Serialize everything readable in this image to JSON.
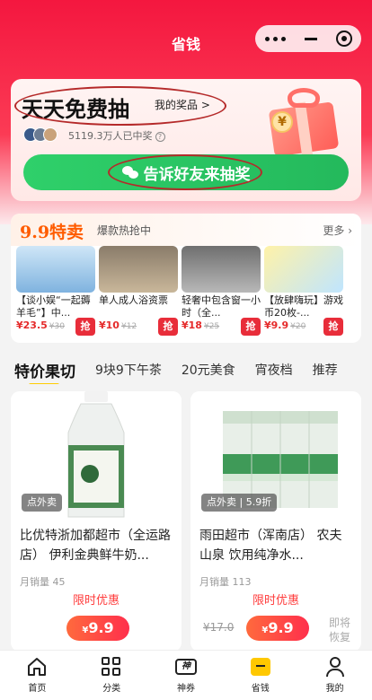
{
  "header": {
    "title": "省钱"
  },
  "lottery": {
    "title": "天天免费抽",
    "prize_link": "我的奖品 >",
    "winners_text": "5119.3万人已中奖",
    "help_icon": "question-icon",
    "share_button": "告诉好友来抽奖"
  },
  "deal_section": {
    "title": "9.9特卖",
    "subtitle": "爆款热抢中",
    "more": "更多 ›",
    "grab_label": "抢",
    "items": [
      {
        "name": "【谈小娱“一起薅羊毛”】中...",
        "price": "¥23.5",
        "old_price": "¥30"
      },
      {
        "name": "单人成人浴资票",
        "price": "¥10",
        "old_price": "¥12"
      },
      {
        "name": "轻奢中包含窗一小时（全...",
        "price": "¥18",
        "old_price": "¥25"
      },
      {
        "name": "【放肆嗨玩】游戏币20枚-...",
        "price": "¥9.9",
        "old_price": "¥20"
      }
    ]
  },
  "tabs": [
    "特价果切",
    "9块9下午茶",
    "20元美食",
    "宵夜档",
    "推荐"
  ],
  "products": [
    {
      "badge": "点外卖",
      "name": "比优特浙加都超市（全运路店） 伊利金典鲜牛奶...",
      "sales": "月销量 45",
      "limited": "限时优惠",
      "price": "9.9",
      "currency": "¥"
    },
    {
      "badge": "点外卖 | 5.9折",
      "name": "雨田超市（浑南店） 农夫山泉 饮用纯净水...",
      "sales": "月销量 113",
      "limited": "限时优惠",
      "price": "9.9",
      "currency": "¥",
      "old_price": "¥17.0",
      "restore": "即将恢复"
    }
  ],
  "bottom_nav": [
    {
      "label": "首页",
      "icon": "home-icon"
    },
    {
      "label": "分类",
      "icon": "grid-icon"
    },
    {
      "label": "神券",
      "icon": "coupon-icon"
    },
    {
      "label": "省钱",
      "icon": "save-money-icon"
    },
    {
      "label": "我的",
      "icon": "user-icon"
    }
  ]
}
